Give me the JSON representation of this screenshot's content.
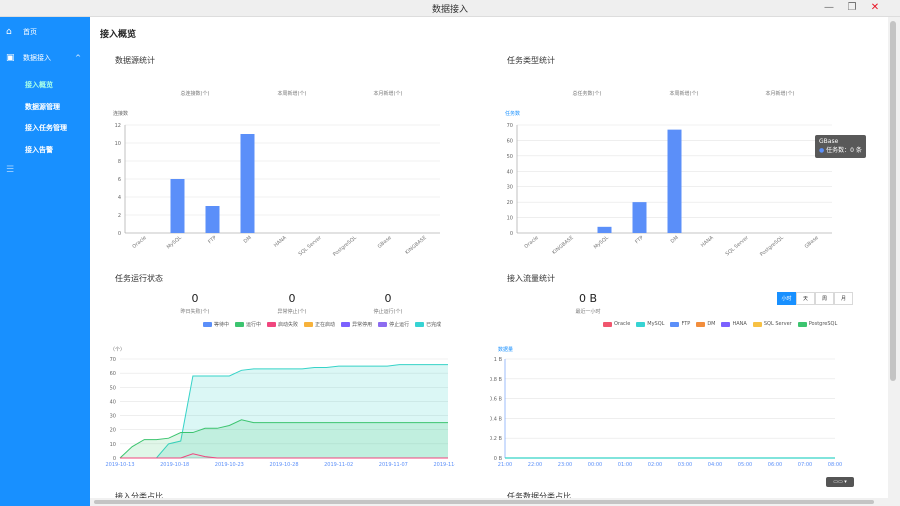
{
  "window": {
    "title": "数据接入",
    "minimize": "—",
    "restore": "❐",
    "close": "✕"
  },
  "sidebar": {
    "home": {
      "label": "首页",
      "icon": "home-icon"
    },
    "data_access": {
      "label": "数据接入",
      "icon": "database-icon"
    },
    "sub": [
      "接入概览",
      "数据源管理",
      "接入任务管理",
      "接入告警"
    ],
    "active_sub": "接入概览"
  },
  "page": {
    "title": "接入概览"
  },
  "panels": {
    "datasource": {
      "title": "数据源统计",
      "stats": [
        {
          "label": "总连接数(个)"
        },
        {
          "label": "本周新增(个)"
        },
        {
          "label": "本月新增(个)"
        }
      ],
      "ylabel": "连接数"
    },
    "tasktype": {
      "title": "任务类型统计",
      "stats": [
        {
          "label": "总任务数(个)"
        },
        {
          "label": "本周新增(个)"
        },
        {
          "label": "本月新增(个)"
        }
      ],
      "ylabel": "任务数",
      "tooltip": {
        "title": "GBase",
        "text": "任务数：0 条"
      }
    },
    "taskrun": {
      "title": "任务运行状态",
      "stats": [
        {
          "value": "0",
          "label": "昨日失败(个)"
        },
        {
          "value": "0",
          "label": "异常停止(个)"
        },
        {
          "value": "0",
          "label": "停止运行(个)"
        }
      ],
      "ylabel": "（个）",
      "legend": [
        "等待中",
        "运行中",
        "启动失败",
        "正在启动",
        "异常停用",
        "停止运行",
        "已完成"
      ]
    },
    "flow": {
      "title": "接入流量统计",
      "stat": {
        "value": "0 B",
        "label": "最近一小时"
      },
      "ylabel": "数据量",
      "tabs": [
        "小时",
        "天",
        "周",
        "月"
      ],
      "active_tab": "小时",
      "legend": [
        "Oracle",
        "MySQL",
        "FTP",
        "DM",
        "HANA",
        "SQL Server",
        "PostgreSQL"
      ]
    },
    "bottom_left": {
      "title": "接入分类占比"
    },
    "bottom_right": {
      "title": "任务数据分类占比"
    }
  },
  "colors": {
    "primary": "#1890ff",
    "bar": "#5b8ff9",
    "teal": "#36d3c8",
    "green": "#3cc46f",
    "pink": "#f0467e",
    "legend": [
      "#5b8ff9",
      "#3cc46f",
      "#f0467e",
      "#f7b23b",
      "#7b61ff",
      "#8c6cf0",
      "#36d3d3"
    ],
    "flow_legend": [
      "#f0566e",
      "#36d3d3",
      "#5b8ff9",
      "#f28d3c",
      "#7b61ff",
      "#f7c144",
      "#3cc46f"
    ]
  },
  "mini_button": "▭▭ ▾",
  "chart_data": [
    {
      "type": "bar",
      "title": "数据源统计",
      "ylabel": "连接数",
      "categories": [
        "Oracle",
        "MySQL",
        "FTP",
        "DM",
        "HANA",
        "SQL Server",
        "PostgreSQL",
        "GBase",
        "KINGBASE"
      ],
      "values": [
        0,
        6,
        3,
        11,
        0,
        0,
        0,
        0,
        0
      ],
      "ylim": [
        0,
        12
      ],
      "yticks": [
        0,
        2,
        4,
        6,
        8,
        10,
        12
      ]
    },
    {
      "type": "bar",
      "title": "任务类型统计",
      "ylabel": "任务数",
      "categories": [
        "Oracle",
        "KINGBASE",
        "MySQL",
        "FTP",
        "DM",
        "HANA",
        "SQL Server",
        "PostgreSQL",
        "GBase"
      ],
      "values": [
        0,
        0,
        4,
        20,
        67,
        0,
        0,
        0,
        0
      ],
      "ylim": [
        0,
        70
      ],
      "yticks": [
        0,
        10,
        20,
        30,
        40,
        50,
        60,
        70
      ]
    },
    {
      "type": "area",
      "title": "任务运行状态",
      "ylabel": "（个）",
      "x": [
        "2019-10-13",
        "2019-10-18",
        "2019-10-23",
        "2019-10-28",
        "2019-11-02",
        "2019-11-07",
        "2019-11-12"
      ],
      "ylim": [
        0,
        70
      ],
      "yticks": [
        0,
        10,
        20,
        30,
        40,
        50,
        60,
        70
      ],
      "series": [
        {
          "name": "已完成",
          "values": [
            0,
            0,
            0,
            0,
            10,
            12,
            58,
            58,
            58,
            58,
            62,
            63,
            63,
            63,
            63,
            63,
            64,
            64,
            65,
            65,
            65,
            65,
            65,
            66,
            66,
            66,
            66,
            66
          ]
        },
        {
          "name": "运行中",
          "values": [
            0,
            8,
            13,
            13,
            14,
            18,
            18,
            21,
            21,
            23,
            27,
            25,
            25,
            25,
            25,
            25,
            25,
            25,
            25,
            25,
            25,
            25,
            25,
            25,
            25,
            25,
            25,
            25
          ]
        },
        {
          "name": "启动失败",
          "values": [
            0,
            0,
            0,
            0,
            0,
            0,
            3,
            1,
            0,
            0,
            0,
            0,
            0,
            0,
            0,
            0,
            0,
            0,
            0,
            0,
            0,
            0,
            0,
            0,
            0,
            0,
            0,
            0
          ]
        }
      ]
    },
    {
      "type": "line",
      "title": "接入流量统计",
      "ylabel": "数据量",
      "x": [
        "21:00",
        "22:00",
        "23:00",
        "00:00",
        "01:00",
        "02:00",
        "03:00",
        "04:00",
        "05:00",
        "06:00",
        "07:00",
        "08:00"
      ],
      "ylim": [
        0,
        1
      ],
      "yticks": [
        "0 B",
        "0.2 B",
        "0.4 B",
        "0.6 B",
        "0.8 B",
        "1 B"
      ],
      "series": [
        {
          "name": "MySQL",
          "values": [
            0,
            0,
            0,
            0,
            0,
            0,
            0,
            0,
            0,
            0,
            0,
            0
          ]
        }
      ]
    }
  ]
}
